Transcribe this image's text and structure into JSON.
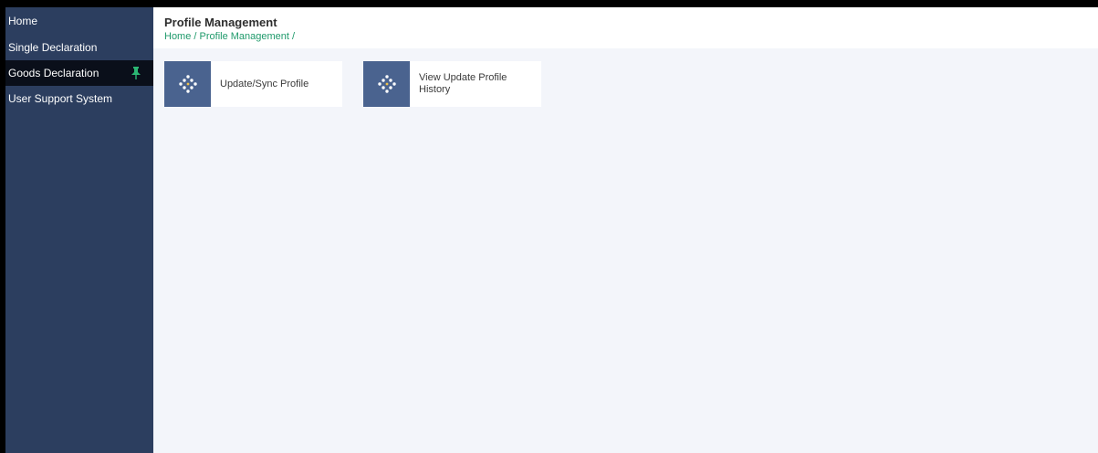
{
  "sidebar": {
    "items": [
      {
        "label": "Home"
      },
      {
        "label": "Single Declaration"
      },
      {
        "label": "Goods Declaration"
      },
      {
        "label": "User Support System"
      }
    ]
  },
  "header": {
    "title": "Profile Management",
    "breadcrumb": {
      "home": "Home",
      "sep1": " / ",
      "current": "Profile Management",
      "sep2": " /"
    }
  },
  "cards": [
    {
      "label": "Update/Sync Profile",
      "icon": "diamond-dots-icon"
    },
    {
      "label": "View Update Profile History",
      "icon": "diamond-dots-icon"
    }
  ],
  "colors": {
    "sidebar_bg": "#2c3e5f",
    "active_item_bg": "#0a0f1a",
    "pin_icon": "#2bb673",
    "breadcrumb": "#1f9a6b",
    "card_icon_bg": "#4a638f",
    "content_bg": "#f3f5fa"
  }
}
